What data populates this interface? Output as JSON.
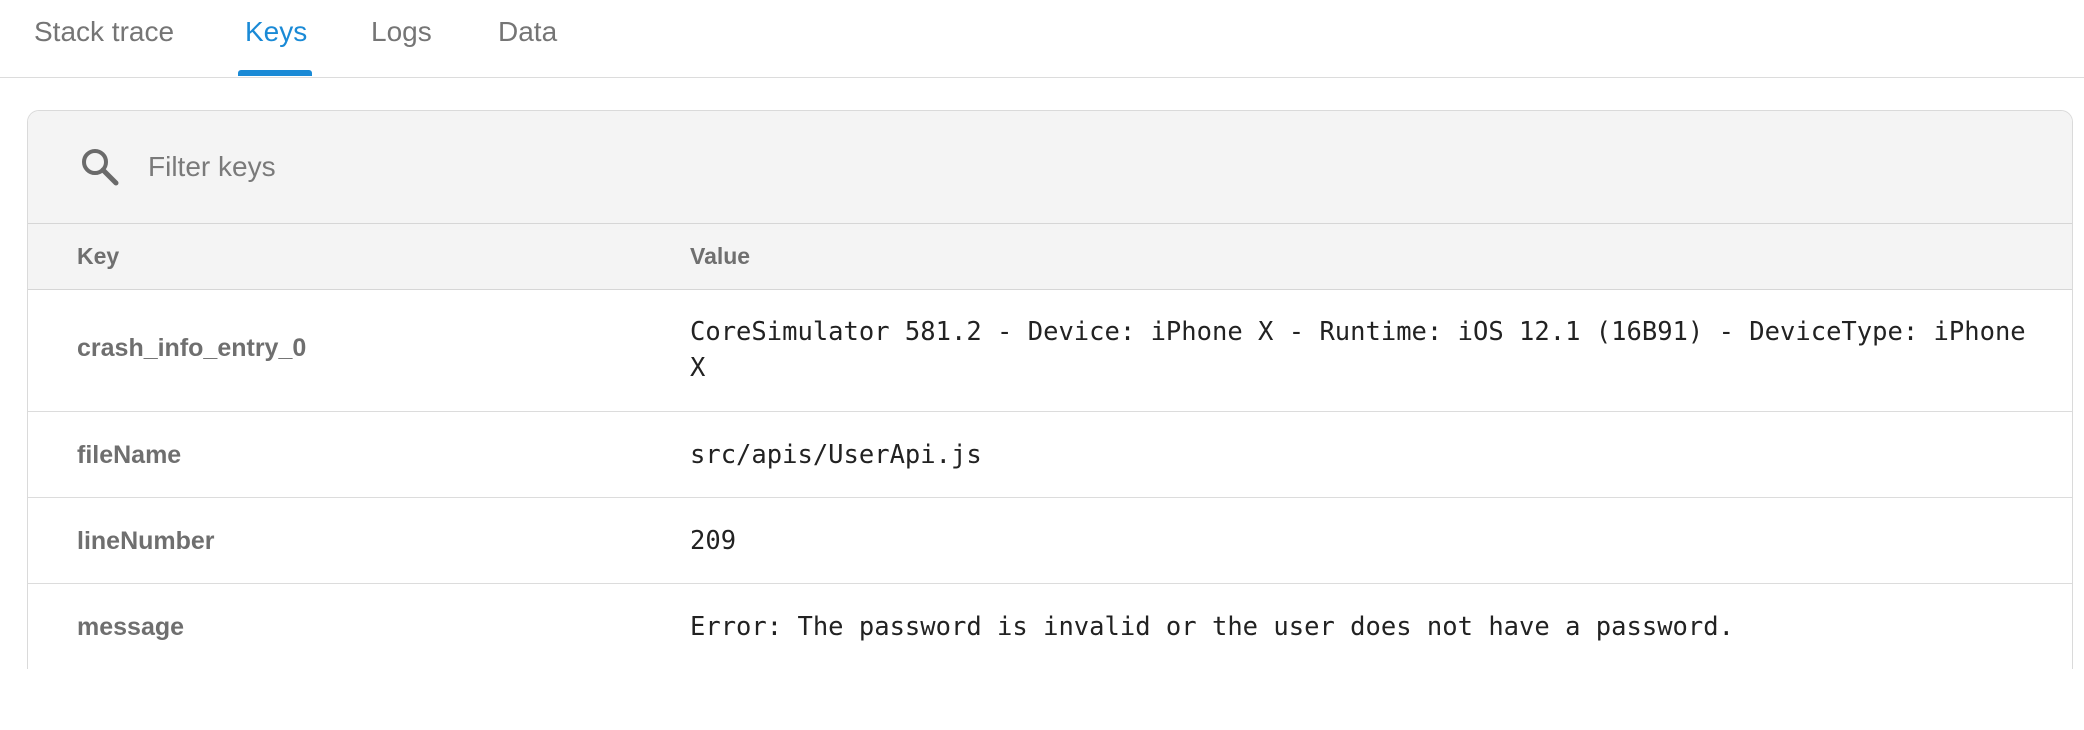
{
  "tabs": [
    {
      "label": "Stack trace",
      "active": false
    },
    {
      "label": "Keys",
      "active": true
    },
    {
      "label": "Logs",
      "active": false
    },
    {
      "label": "Data",
      "active": false
    }
  ],
  "filter": {
    "placeholder": "Filter keys",
    "value": "",
    "icon": "search-icon"
  },
  "table": {
    "columns": [
      "Key",
      "Value"
    ],
    "rows": [
      {
        "key": "crash_info_entry_0",
        "value": "CoreSimulator 581.2 - Device: iPhone X - Runtime: iOS 12.1 (16B91) - DeviceType: iPhone X"
      },
      {
        "key": "fileName",
        "value": "src/apis/UserApi.js"
      },
      {
        "key": "lineNumber",
        "value": "209"
      },
      {
        "key": "message",
        "value": "Error: The password is invalid or the user does not have a password."
      }
    ]
  },
  "colors": {
    "accent": "#1a8ad6",
    "header_bg": "#f4f4f4",
    "muted_text": "#757575",
    "border": "#dcdcdc"
  }
}
